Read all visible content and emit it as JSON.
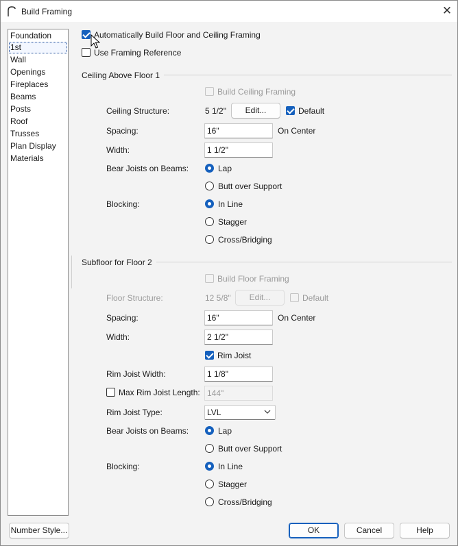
{
  "window": {
    "title": "Build Framing",
    "app_icon": "arch-icon",
    "close_icon": "close-icon"
  },
  "nav": {
    "items": [
      "Foundation",
      "1st",
      "Wall",
      "Openings",
      "Fireplaces",
      "Beams",
      "Posts",
      "Roof",
      "Trusses",
      "Plan Display",
      "Materials"
    ],
    "selected": "1st"
  },
  "top": {
    "auto_build": {
      "label": "Automatically Build Floor and Ceiling Framing",
      "checked": true
    },
    "use_ref": {
      "label": "Use Framing Reference",
      "checked": false
    }
  },
  "ceiling": {
    "section_title": "Ceiling Above Floor 1",
    "build": {
      "label": "Build Ceiling Framing",
      "checked": false,
      "disabled": true
    },
    "structure_label": "Ceiling Structure:",
    "structure_value": "5 1/2\"",
    "edit_label": "Edit...",
    "default": {
      "label": "Default",
      "checked": true
    },
    "spacing_label": "Spacing:",
    "spacing_value": "16\"",
    "on_center": "On Center",
    "width_label": "Width:",
    "width_value": "1 1/2\"",
    "bear_label": "Bear Joists on Beams:",
    "bear_options": [
      "Lap",
      "Butt over Support"
    ],
    "bear_selected": "Lap",
    "blocking_label": "Blocking:",
    "blocking_options": [
      "In Line",
      "Stagger",
      "Cross/Bridging"
    ],
    "blocking_selected": "In Line"
  },
  "subfloor": {
    "section_title": "Subfloor for Floor 2",
    "build": {
      "label": "Build Floor Framing",
      "checked": false,
      "disabled": true
    },
    "structure_label": "Floor Structure:",
    "structure_value": "12 5/8\"",
    "edit_label": "Edit...",
    "default": {
      "label": "Default",
      "checked": false,
      "disabled": true
    },
    "spacing_label": "Spacing:",
    "spacing_value": "16\"",
    "on_center": "On Center",
    "width_label": "Width:",
    "width_value": "2 1/2\"",
    "rim_joist": {
      "label": "Rim Joist",
      "checked": true
    },
    "rim_width_label": "Rim Joist Width:",
    "rim_width_value": "1 1/8\"",
    "max_rim": {
      "label": "Max Rim Joist Length:",
      "checked": false
    },
    "max_rim_value": "144\"",
    "rim_type_label": "Rim Joist Type:",
    "rim_type_value": "LVL",
    "bear_label": "Bear Joists on Beams:",
    "bear_options": [
      "Lap",
      "Butt over Support"
    ],
    "bear_selected": "Lap",
    "blocking_label": "Blocking:",
    "blocking_options": [
      "In Line",
      "Stagger",
      "Cross/Bridging"
    ],
    "blocking_selected": "In Line"
  },
  "footer": {
    "number_style": "Number Style...",
    "ok": "OK",
    "cancel": "Cancel",
    "help": "Help"
  },
  "colors": {
    "accent": "#1560bd",
    "background": "#f3f3f3",
    "disabled_text": "#9a9a9a"
  }
}
